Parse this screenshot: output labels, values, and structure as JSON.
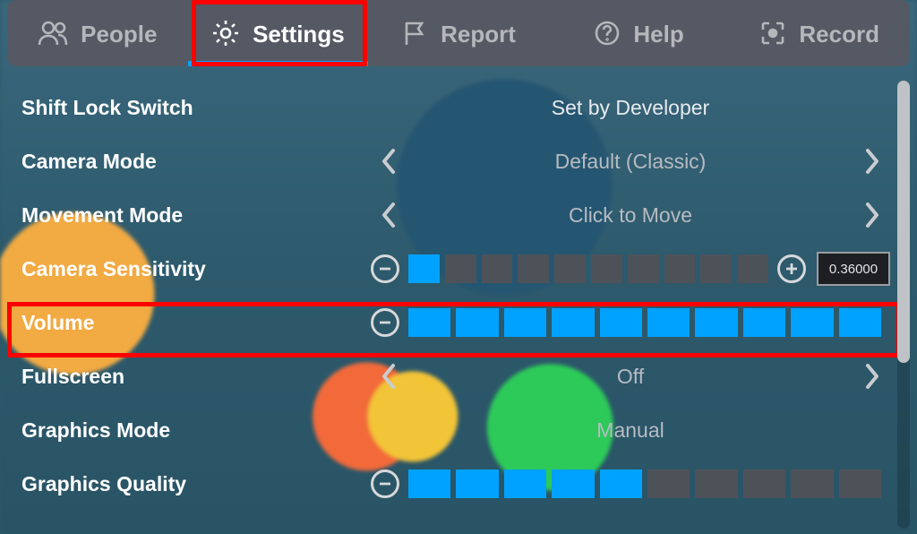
{
  "tabs": {
    "people": "People",
    "settings": "Settings",
    "report": "Report",
    "help": "Help",
    "record": "Record"
  },
  "settings": {
    "shift_lock": {
      "label": "Shift Lock Switch",
      "value": "Set by Developer"
    },
    "camera_mode": {
      "label": "Camera Mode",
      "value": "Default (Classic)"
    },
    "movement": {
      "label": "Movement Mode",
      "value": "Click to Move"
    },
    "sensitivity": {
      "label": "Camera Sensitivity",
      "segments": 10,
      "filled": 1,
      "readout": "0.36000"
    },
    "volume": {
      "label": "Volume",
      "segments": 10,
      "filled": 10
    },
    "fullscreen": {
      "label": "Fullscreen",
      "value": "Off"
    },
    "gfx_mode": {
      "label": "Graphics Mode",
      "value": "Manual"
    },
    "gfx_quality": {
      "label": "Graphics Quality",
      "segments": 10,
      "filled": 5
    }
  },
  "colors": {
    "accent": "#00a2ff",
    "highlight": "#ff0000"
  }
}
